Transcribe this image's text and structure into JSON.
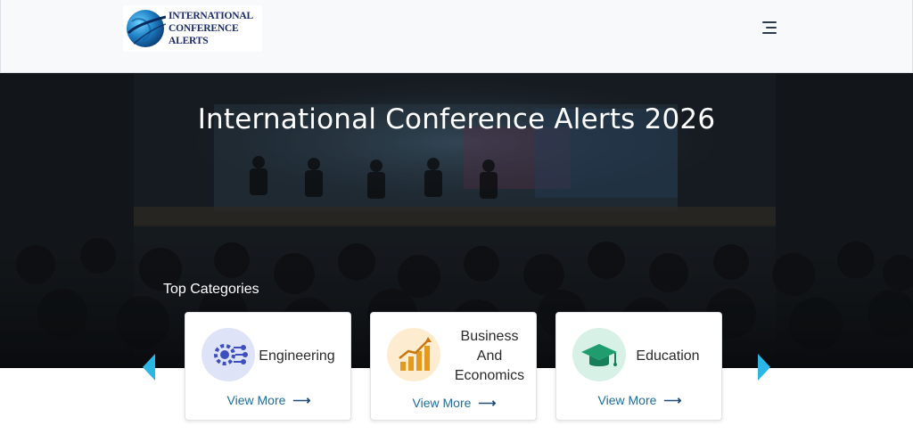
{
  "header": {
    "logo": {
      "line1": "INTERNATIONAL",
      "line2": "CONFERENCE",
      "line3": "ALERTS"
    },
    "menu_icon": "hamburger-menu-icon"
  },
  "hero": {
    "title": "International Conference Alerts 2026",
    "section_label": "Top Categories"
  },
  "categories": [
    {
      "name": "Engineering",
      "view_more": "View More",
      "icon": "engineering-circuit-gear-icon",
      "icon_bg": "#dfe3f7",
      "icon_color": "#4a5bc4"
    },
    {
      "name_line1": "Business",
      "name_line2": "And",
      "name_line3": "Economics",
      "view_more": "View More",
      "icon": "bar-chart-growth-icon",
      "icon_bg": "#fdeccf",
      "icon_color": "#e39a1e"
    },
    {
      "name": "Education",
      "view_more": "View More",
      "icon": "graduation-cap-icon",
      "icon_bg": "#d7f1e6",
      "icon_color": "#1f9d6e"
    }
  ],
  "carousel": {
    "prev_icon": "chevron-left-icon",
    "next_icon": "chevron-right-icon",
    "arrow_color": "#2ab7e6"
  },
  "colors": {
    "link": "#1f6d99",
    "header_bg": "#f8f9fb",
    "title": "#ffffff"
  }
}
